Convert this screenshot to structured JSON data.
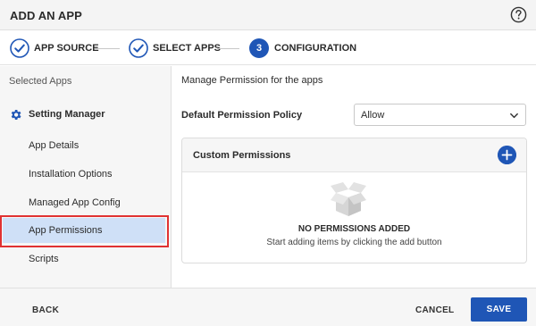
{
  "header": {
    "title": "ADD AN APP",
    "help_icon": "question-circle-icon"
  },
  "stepper": {
    "steps": [
      {
        "label": "APP SOURCE",
        "state": "complete",
        "icon": "check-circle-icon"
      },
      {
        "label": "SELECT APPS",
        "state": "complete",
        "icon": "check-circle-icon"
      },
      {
        "label": "CONFIGURATION",
        "state": "active",
        "number": "3"
      }
    ]
  },
  "sidebar": {
    "heading": "Selected Apps",
    "group": {
      "label": "Setting Manager",
      "icon": "gear-icon"
    },
    "items": [
      {
        "label": "App Details"
      },
      {
        "label": "Installation Options"
      },
      {
        "label": "Managed App Config"
      },
      {
        "label": "App Permissions",
        "active": true
      },
      {
        "label": "Scripts"
      }
    ]
  },
  "main": {
    "description": "Manage Permission for the apps",
    "policy_label": "Default Permission Policy",
    "policy_value": "Allow",
    "custom_permissions": {
      "title": "Custom Permissions",
      "add_icon": "plus-icon",
      "empty_icon": "open-box-icon",
      "empty_title": "NO PERMISSIONS ADDED",
      "empty_subtitle": "Start adding items by clicking the add button"
    }
  },
  "footer": {
    "back_label": "BACK",
    "cancel_label": "CANCEL",
    "save_label": "SAVE"
  },
  "colors": {
    "accent": "#1f56b6",
    "active_item_bg": "#cfe0f7",
    "highlight_border": "#e03232"
  }
}
